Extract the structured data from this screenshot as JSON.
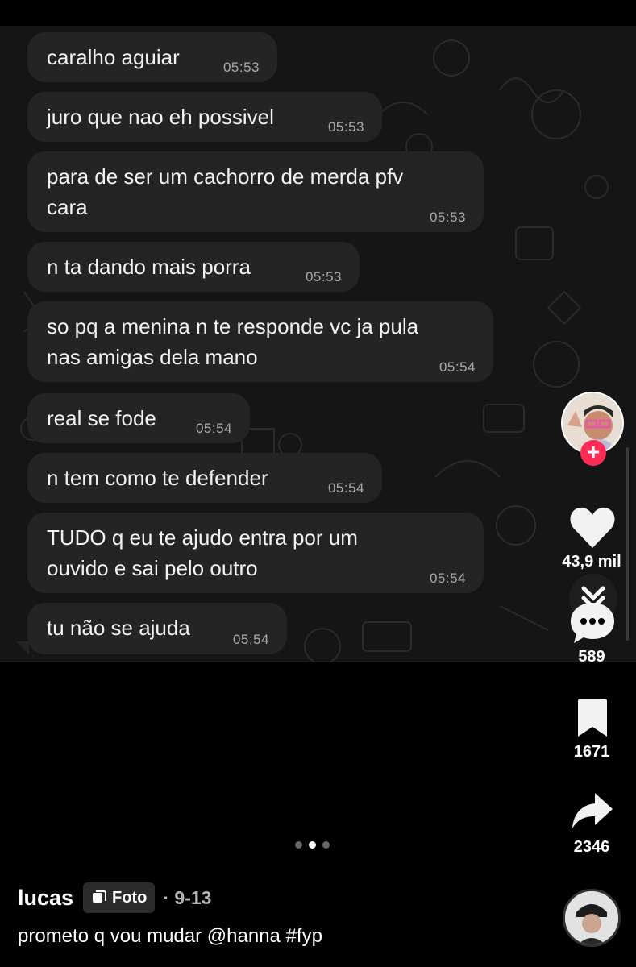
{
  "messages": [
    {
      "text": "caralho aguiar",
      "time": "05:53"
    },
    {
      "text": "juro que nao eh possivel",
      "time": "05:53"
    },
    {
      "text": "para de ser um cachorro de merda pfv\ncara",
      "time": "05:53"
    },
    {
      "text": "n ta dando mais porra",
      "time": "05:53"
    },
    {
      "text": "so pq a menina n te responde vc ja pula\nnas amigas dela mano",
      "time": "05:54"
    },
    {
      "text": "real se fode",
      "time": "05:54"
    },
    {
      "text": "n tem como te defender",
      "time": "05:54"
    },
    {
      "text": "TUDO q eu te ajudo entra por um\nouvido e sai pelo outro",
      "time": "05:54"
    },
    {
      "text": "tu não se ajuda",
      "time": "05:54"
    }
  ],
  "rail": {
    "likes": "43,9 mil",
    "comments": "589",
    "saves": "1671",
    "shares": "2346",
    "icons": [
      "profile-avatar",
      "follow-plus-icon",
      "heart-icon",
      "chevron-down-icon",
      "comment-icon",
      "bookmark-icon",
      "share-icon"
    ],
    "follow_symbol": "+"
  },
  "carousel": {
    "count": 3,
    "active": 1
  },
  "post": {
    "username": "lucas",
    "badge": "Foto",
    "date": "· 9-13",
    "caption": "prometo q vou mudar @hanna #fyp"
  },
  "colors": {
    "bubble": "#232423",
    "chat_bg": "#151515",
    "follow_button": "#fe2c55"
  }
}
